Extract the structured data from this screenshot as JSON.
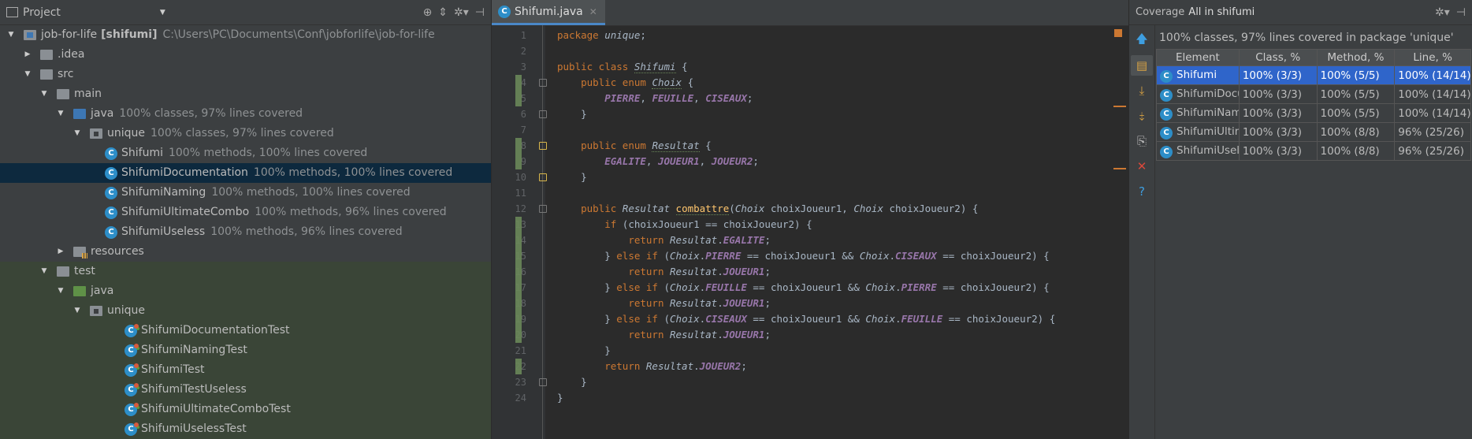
{
  "project": {
    "title": "Project",
    "tree": [
      {
        "name": "job-for-life",
        "bold_suffix": "[shifumi]",
        "hint": "C:\\Users\\PC\\Documents\\Conf\\jobforlife\\job-for-life"
      },
      {
        "name": ".idea",
        "hint": ""
      },
      {
        "name": "src",
        "hint": ""
      },
      {
        "name": "main",
        "hint": ""
      },
      {
        "name": "java",
        "hint": "100% classes, 97% lines covered"
      },
      {
        "name": "unique",
        "hint": "100% classes, 97% lines covered"
      },
      {
        "name": "Shifumi",
        "hint": "100% methods, 100% lines covered"
      },
      {
        "name": "ShifumiDocumentation",
        "hint": "100% methods, 100% lines covered"
      },
      {
        "name": "ShifumiNaming",
        "hint": "100% methods, 100% lines covered"
      },
      {
        "name": "ShifumiUltimateCombo",
        "hint": "100% methods, 96% lines covered"
      },
      {
        "name": "ShifumiUseless",
        "hint": "100% methods, 96% lines covered"
      },
      {
        "name": "resources",
        "hint": ""
      },
      {
        "name": "test",
        "hint": ""
      },
      {
        "name": "java",
        "hint": ""
      },
      {
        "name": "unique",
        "hint": ""
      },
      {
        "name": "ShifumiDocumentationTest",
        "hint": ""
      },
      {
        "name": "ShifumiNamingTest",
        "hint": ""
      },
      {
        "name": "ShifumiTest",
        "hint": ""
      },
      {
        "name": "ShifumiTestUseless",
        "hint": ""
      },
      {
        "name": "ShifumiUltimateComboTest",
        "hint": ""
      },
      {
        "name": "ShifumiUselessTest",
        "hint": ""
      }
    ]
  },
  "editor": {
    "tab_label": "Shifumi.java",
    "line_numbers": [
      "1",
      "2",
      "3",
      "4",
      "5",
      "6",
      "7",
      "8",
      "9",
      "10",
      "11",
      "12",
      "13",
      "14",
      "15",
      "16",
      "17",
      "18",
      "19",
      "20",
      "21",
      "22",
      "23",
      "24"
    ]
  },
  "coverage": {
    "title": "Coverage",
    "scope": "All in shifumi",
    "summary": "100% classes, 97% lines covered in package 'unique'",
    "columns": [
      "Element",
      "Class, %",
      "Method, %",
      "Line, %"
    ],
    "rows": [
      {
        "element": "Shifumi",
        "cls": "100% (3/3)",
        "method": "100% (5/5)",
        "line": "100% (14/14)"
      },
      {
        "element": "ShifumiDocumentation",
        "cls": "100% (3/3)",
        "method": "100% (5/5)",
        "line": "100% (14/14)"
      },
      {
        "element": "ShifumiNaming",
        "cls": "100% (3/3)",
        "method": "100% (5/5)",
        "line": "100% (14/14)"
      },
      {
        "element": "ShifumiUltimateCombo",
        "cls": "100% (3/3)",
        "method": "100% (8/8)",
        "line": "96% (25/26)"
      },
      {
        "element": "ShifumiUseless",
        "cls": "100% (3/3)",
        "method": "100% (8/8)",
        "line": "96% (25/26)"
      }
    ]
  },
  "colors": {
    "accent": "#2f65ca",
    "selection": "#0d293e",
    "coverage_green": "#6a8759",
    "keyword": "#cc7832"
  }
}
